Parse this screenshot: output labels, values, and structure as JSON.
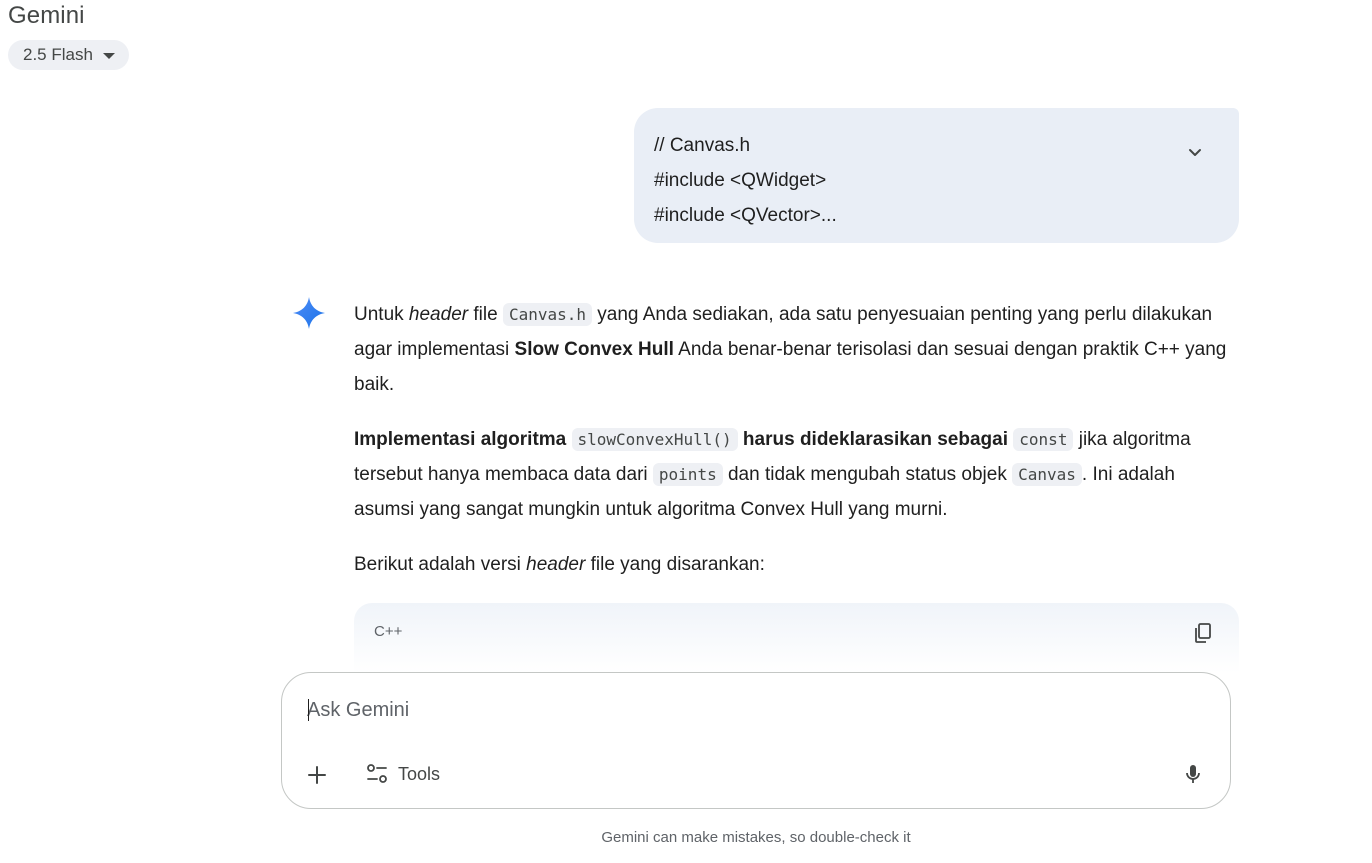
{
  "app": {
    "title": "Gemini",
    "model": "2.5 Flash"
  },
  "user_message": {
    "lines": [
      "// Canvas.h",
      "#include <QWidget>",
      "#include <QVector>..."
    ],
    "expand_icon": "chevron-down-icon"
  },
  "response": {
    "p1": {
      "t1": "Untuk ",
      "header_italic": "header",
      "t2": " file ",
      "code": "Canvas.h",
      "t3": " yang Anda sediakan, ada satu penyesuaian penting yang perlu dilakukan agar implementasi ",
      "bold": "Slow Convex Hull",
      "t4": " Anda benar-benar terisolasi dan sesuai dengan praktik C++ yang baik."
    },
    "p2": {
      "bold1": "Implementasi algoritma",
      "code1": "slowConvexHull()",
      "bold2": "harus dideklarasikan sebagai",
      "code2": "const",
      "t1": " jika algoritma tersebut hanya membaca data dari ",
      "code3": "points",
      "t2": " dan tidak mengubah status objek ",
      "code4": "Canvas",
      "t3": ". Ini adalah asumsi yang sangat mungkin untuk algoritma Convex Hull yang murni."
    },
    "p3": {
      "t1": "Berikut adalah versi ",
      "header_italic": "header",
      "t2": " file yang disarankan:"
    },
    "code_block": {
      "language": "C++",
      "copy_icon": "copy-icon"
    }
  },
  "composer": {
    "placeholder": "Ask Gemini",
    "value": "",
    "tools_label": "Tools"
  },
  "footer": {
    "disclaimer": "Gemini can make mistakes, so double-check it"
  },
  "colors": {
    "accent": "#1a73e8",
    "bubble": "#e9eef6",
    "chip": "#eef0f4"
  }
}
